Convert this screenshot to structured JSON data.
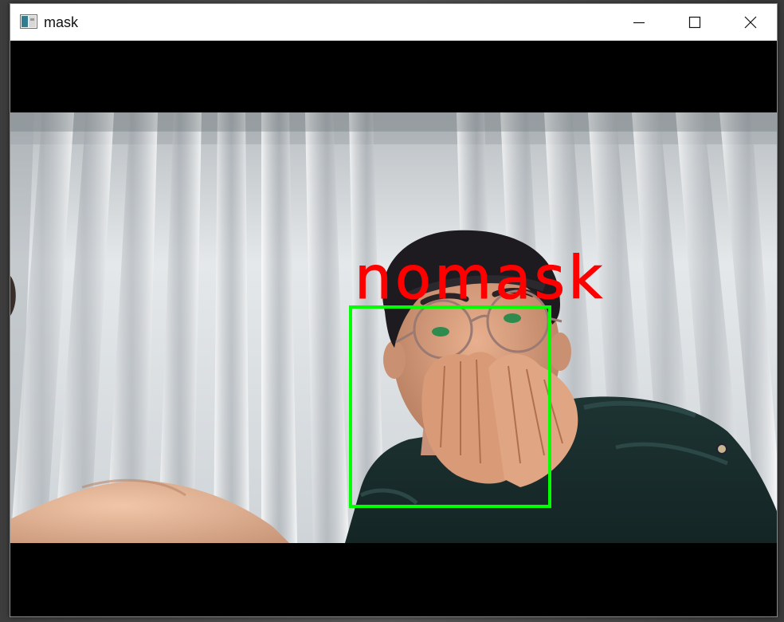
{
  "window": {
    "title": "mask",
    "icon": "opencv-window-icon",
    "controls": {
      "minimize_icon": "minimize-icon",
      "maximize_icon": "maximize-icon",
      "close_icon": "close-icon"
    }
  },
  "video": {
    "overlay_label": "nomask",
    "overlay_label_color": "#ff0000",
    "detection_box_color": "#00ff00"
  }
}
